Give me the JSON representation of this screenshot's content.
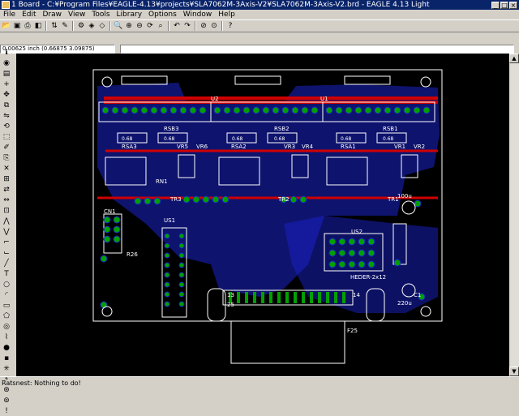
{
  "window": {
    "title": "1 Board - C:¥Program Files¥EAGLE-4.13¥projects¥SLA7062M-3Axis-V2¥SLA7062M-3Axis-V2.brd - EAGLE 4.13 Light",
    "minimize": "_",
    "maximize": "□",
    "close": "×"
  },
  "menu": [
    "File",
    "Edit",
    "Draw",
    "View",
    "Tools",
    "Library",
    "Options",
    "Window",
    "Help"
  ],
  "toolbar_icons": [
    "folder-open-icon",
    "save-icon",
    "print-icon",
    "cam-icon",
    "board-switch-icon",
    "script-icon",
    "run-icon",
    "drc-icon",
    "erc-icon",
    "zoom-fit-icon",
    "zoom-in-icon",
    "zoom-out-icon",
    "redraw-icon",
    "zoom-select-icon",
    "undo-icon",
    "redo-icon",
    "stop-icon",
    "go-icon",
    "help-icon"
  ],
  "command": {
    "coordinates": "0.00625 inch (0.66875 3.09875)",
    "input_value": ""
  },
  "left_tools": [
    "info-icon",
    "show-icon",
    "display-icon",
    "mark-icon",
    "move-icon",
    "copy-icon",
    "mirror-icon",
    "rotate-icon",
    "group-icon",
    "change-icon",
    "paste-icon",
    "delete-icon",
    "add-icon",
    "pinswap-icon",
    "replace-icon",
    "lock-icon",
    "split-icon",
    "optimize-icon",
    "route-icon",
    "ripup-icon",
    "wire-icon",
    "text-icon",
    "circle-icon",
    "arc-icon",
    "rect-icon",
    "polygon-icon",
    "via-icon",
    "signal-icon",
    "hole-icon",
    "attribute-icon",
    "ratsnest-icon",
    "auto-icon",
    "erc-icon",
    "drc-icon",
    "errors-icon"
  ],
  "board": {
    "labels": [
      "U2",
      "U1",
      "RSB3",
      "RSB2",
      "RSB1",
      "RSA3",
      "RSA2",
      "RSA1",
      "VR6",
      "VR5",
      "VR4",
      "VR3",
      "VR2",
      "VR1",
      "RN1",
      "TR3",
      "TR2",
      "TR1",
      "CN1",
      "US1",
      "US2",
      "HEDER-2x12",
      "R26",
      "F25",
      "13",
      "14",
      "25",
      "100u",
      "220u",
      "C1"
    ],
    "smd_values": [
      "0.68",
      "0.68",
      "0.68",
      "0.68",
      "0.68",
      "0.68"
    ]
  },
  "status": {
    "text": "Ratsnest: Nothing to do!"
  },
  "colors": {
    "titlebar": "#0a246a",
    "canvas": "#000000",
    "top_copper": "#d00000",
    "bottom_copper": "#1a22c8",
    "pad": "#00a000",
    "silkscreen": "#ffffff"
  }
}
